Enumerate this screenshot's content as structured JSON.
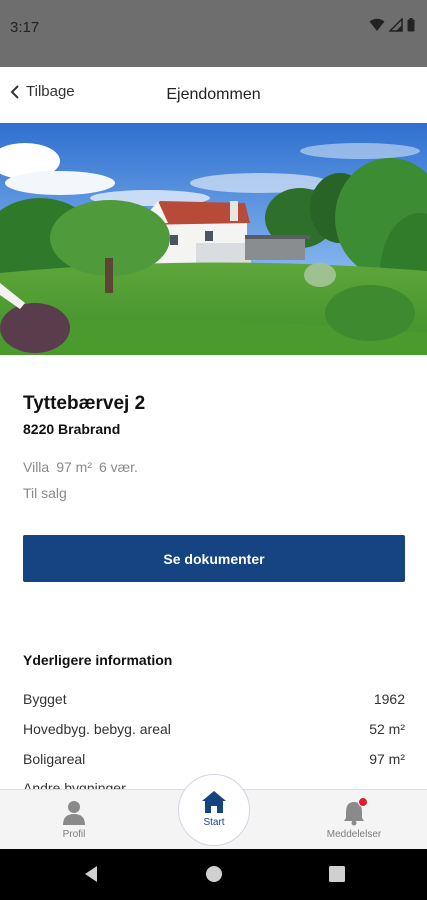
{
  "status_bar": {
    "time": "3:17"
  },
  "topnav": {
    "back_label": "Tilbage",
    "title": "Ejendommen"
  },
  "property": {
    "address": "Tyttebærvej 2",
    "postal": "8220 Brabrand",
    "type": "Villa",
    "area": "97 m²",
    "rooms": "6 vær.",
    "status": "Til salg"
  },
  "actions": {
    "documents_label": "Se dokumenter"
  },
  "info": {
    "heading": "Yderligere information",
    "rows": [
      {
        "label": "Bygget",
        "value": "1962"
      },
      {
        "label": "Hovedbyg. bebyg. areal",
        "value": "52 m²"
      },
      {
        "label": "Boligareal",
        "value": "97 m²"
      },
      {
        "label": "Andre bygninger",
        "value": ""
      }
    ]
  },
  "tabs": {
    "profile": "Profil",
    "home": "Start",
    "notifications": "Meddelelser"
  },
  "colors": {
    "accent": "#164382",
    "badge": "#e8192c"
  }
}
